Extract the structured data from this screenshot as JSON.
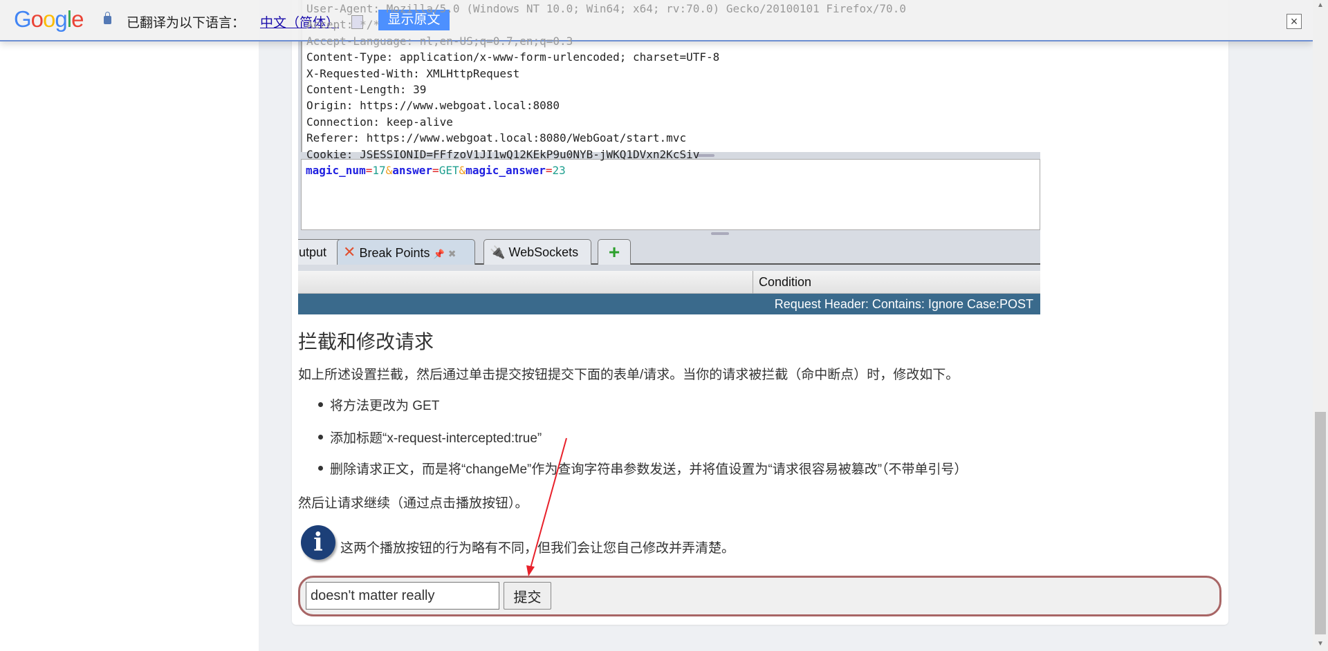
{
  "translate_bar": {
    "logo": "Google",
    "label": "已翻译为以下语言：",
    "language": "中文（简体）",
    "show_original": "显示原文",
    "close": "×"
  },
  "burp": {
    "headers": [
      "User-Agent: Mozilla/5.0 (Windows NT 10.0; Win64; x64; rv:70.0) Gecko/20100101 Firefox/70.0",
      "Accept: */*",
      "Accept-Language: nl,en-US;q=0.7,en;q=0.3",
      "Content-Type: application/x-www-form-urlencoded; charset=UTF-8",
      "X-Requested-With: XMLHttpRequest",
      "Content-Length: 39",
      "Origin: https://www.webgoat.local:8080",
      "Connection: keep-alive",
      "Referer: https://www.webgoat.local:8080/WebGoat/start.mvc",
      "Cookie: JSESSIONID=FFfzoV1JI1wQ12KEkP9u0NYB-jWKQ1DVxn2KcSiv"
    ],
    "body": {
      "k1": "magic_num",
      "v1": "17",
      "k2": "answer",
      "v2": "GET",
      "k3": "magic_answer",
      "v3": "23",
      "eq": "=",
      "amp": "&"
    },
    "tabs": {
      "output": "utput",
      "breakpoints": "Break Points",
      "websockets": "WebSockets",
      "add": "+"
    },
    "table": {
      "column": "Condition",
      "row": "Request Header: Contains: Ignore Case:POST"
    }
  },
  "lesson": {
    "heading": "拦截和修改请求",
    "intro": "如上所述设置拦截，然后通过单击提交按钮提交下面的表单/请求。当你的请求被拦截（命中断点）时，修改如下。",
    "bullets": [
      "将方法更改为 GET",
      "添加标题“x-request-intercepted:true”",
      "删除请求正文，而是将“changeMe”作为查询字符串参数发送，并将值设置为“请求很容易被篡改”（不带单引号）"
    ],
    "continue": "然后让请求继续（通过点击播放按钮）。",
    "info": "这两个播放按钮的行为略有不同，但我们会让您自己修改并弄清楚。",
    "form": {
      "input_value": "doesn't matter really",
      "submit": "提交"
    }
  },
  "annotation_color": "#e8202a",
  "form_border_color": "#a86565"
}
